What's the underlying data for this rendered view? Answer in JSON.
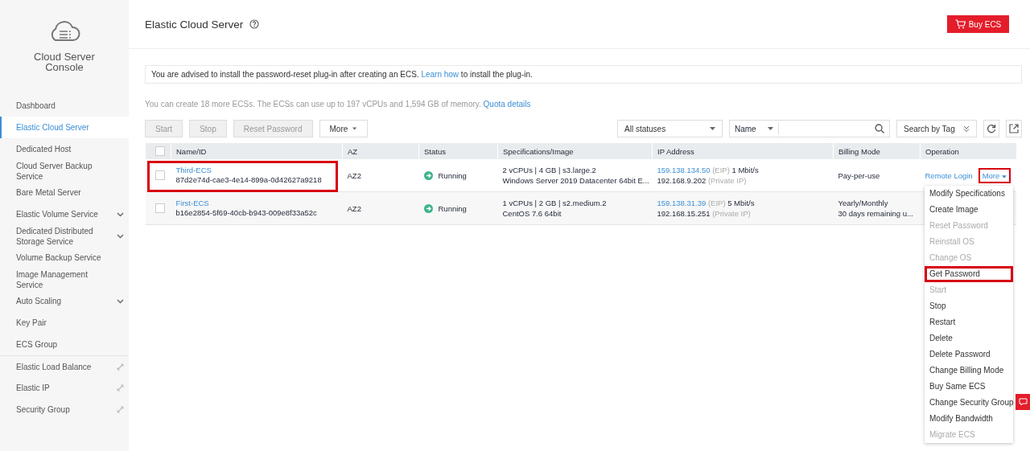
{
  "sidebar": {
    "title": "Cloud Server Console",
    "items": [
      {
        "label": "Dashboard",
        "kind": "plain",
        "selected": false
      },
      {
        "label": "Elastic Cloud Server",
        "kind": "plain",
        "selected": true
      },
      {
        "label": "Dedicated Host",
        "kind": "plain",
        "selected": false
      },
      {
        "label": "Cloud Server Backup Service",
        "kind": "plain",
        "selected": false
      },
      {
        "label": "Bare Metal Server",
        "kind": "plain",
        "selected": false
      },
      {
        "label": "Elastic Volume Service",
        "kind": "expand",
        "selected": false
      },
      {
        "label": "Dedicated Distributed Storage Service",
        "kind": "expand",
        "selected": false
      },
      {
        "label": "Volume Backup Service",
        "kind": "plain",
        "selected": false
      },
      {
        "label": "Image Management Service",
        "kind": "plain",
        "selected": false
      },
      {
        "label": "Auto Scaling",
        "kind": "expand",
        "selected": false
      },
      {
        "label": "Key Pair",
        "kind": "plain",
        "selected": false
      },
      {
        "label": "ECS Group",
        "kind": "plain",
        "selected": false
      },
      {
        "label": "Elastic Load Balance",
        "kind": "external",
        "selected": false
      },
      {
        "label": "Elastic IP",
        "kind": "external",
        "selected": false
      },
      {
        "label": "Security Group",
        "kind": "external",
        "selected": false
      }
    ]
  },
  "header": {
    "title": "Elastic Cloud Server",
    "buy_button": "Buy ECS"
  },
  "notice": {
    "before": "You are advised to install the password-reset plug-in after creating an ECS.",
    "link": "Learn how",
    "after": "to install the plug-in."
  },
  "quota": {
    "text": "You can create 18 more ECSs. The ECSs can use up to 197 vCPUs and 1,594 GB of memory.",
    "link": "Quota details"
  },
  "toolbar": {
    "buttons": [
      {
        "label": "Start",
        "disabled": true
      },
      {
        "label": "Stop",
        "disabled": true
      },
      {
        "label": "Reset Password",
        "disabled": true
      }
    ],
    "more": "More",
    "status_filter": "All statuses",
    "search_attr": "Name",
    "tag_search": "Search by Tag"
  },
  "table": {
    "select_all_checked": false,
    "columns": [
      "Name/ID",
      "AZ",
      "Status",
      "Specifications/Image",
      "IP Address",
      "Billing Mode",
      "Operation"
    ],
    "rows": [
      {
        "highlighted": true,
        "checked": false,
        "name": "Third-ECS",
        "id": "87d2e74d-cae3-4e14-899a-0d42627a9218",
        "az": "AZ2",
        "status": "Running",
        "spec": "2 vCPUs | 4 GB | s3.large.2",
        "image": "Windows Server 2019 Datacenter 64bit E...",
        "eip": "159.138.134.50",
        "eip_label": "(EIP)",
        "bandwidth": "1 Mbit/s",
        "private_ip": "192.168.9.202",
        "private_label": "(Private IP)",
        "billing": [
          "Pay-per-use"
        ],
        "operations": {
          "remote_login": "Remote Login",
          "more": "More",
          "more_highlighted": true
        }
      },
      {
        "highlighted": false,
        "checked": false,
        "name": "First-ECS",
        "id": "b16e2854-5f69-40cb-b943-009e8f33a52c",
        "az": "AZ2",
        "status": "Running",
        "spec": "1 vCPUs | 2 GB | s2.medium.2",
        "image": "CentOS 7.6 64bit",
        "eip": "159.138.31.39",
        "eip_label": "(EIP)",
        "bandwidth": "5 Mbit/s",
        "private_ip": "192.168.15.251",
        "private_label": "(Private IP)",
        "billing": [
          "Yearly/Monthly",
          "30 days remaining u..."
        ]
      }
    ]
  },
  "more_menu": [
    {
      "label": "Modify Specifications",
      "disabled": false,
      "highlighted": false
    },
    {
      "label": "Create Image",
      "disabled": false,
      "highlighted": false
    },
    {
      "label": "Reset Password",
      "disabled": true,
      "highlighted": false
    },
    {
      "label": "Reinstall OS",
      "disabled": true,
      "highlighted": false
    },
    {
      "label": "Change OS",
      "disabled": true,
      "highlighted": false
    },
    {
      "label": "Get Password",
      "disabled": false,
      "highlighted": true
    },
    {
      "label": "Start",
      "disabled": true,
      "highlighted": false
    },
    {
      "label": "Stop",
      "disabled": false,
      "highlighted": false
    },
    {
      "label": "Restart",
      "disabled": false,
      "highlighted": false
    },
    {
      "label": "Delete",
      "disabled": false,
      "highlighted": false
    },
    {
      "label": "Delete Password",
      "disabled": false,
      "highlighted": false
    },
    {
      "label": "Change Billing Mode",
      "disabled": false,
      "highlighted": false
    },
    {
      "label": "Buy Same ECS",
      "disabled": false,
      "highlighted": false
    },
    {
      "label": "Change Security Group",
      "disabled": false,
      "highlighted": false
    },
    {
      "label": "Modify Bandwidth",
      "disabled": false,
      "highlighted": false
    },
    {
      "label": "Migrate ECS",
      "disabled": true,
      "highlighted": false
    }
  ]
}
